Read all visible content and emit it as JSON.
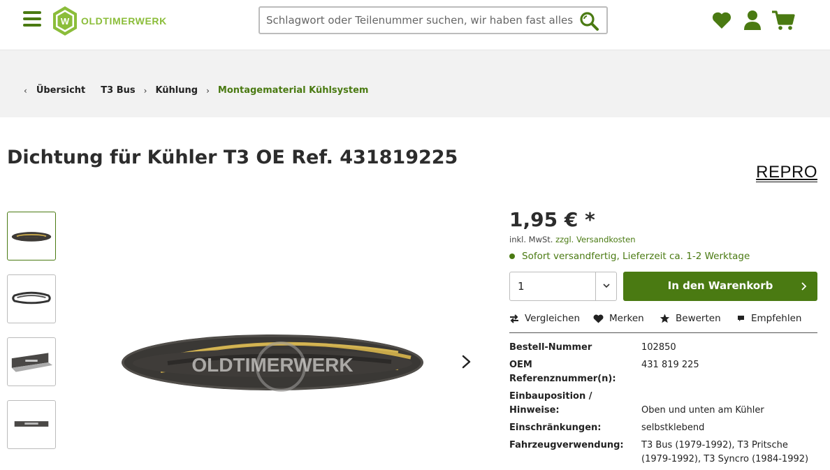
{
  "header": {
    "logo_text": "OLDTIMERWERK",
    "search_placeholder": "Schlagwort oder Teilenummer suchen, wir haben fast alles!",
    "icons": [
      "menu-icon",
      "heart-icon",
      "user-icon",
      "cart-icon",
      "search-icon"
    ]
  },
  "breadcrumb": [
    {
      "label": "Übersicht"
    },
    {
      "label": "T3 Bus"
    },
    {
      "label": "Kühlung"
    },
    {
      "label": "Montagematerial Kühlsystem"
    }
  ],
  "product": {
    "title": "Dichtung für Kühler T3 OE Ref. 431819225",
    "brand": "REPRO",
    "price": "1,95 € *",
    "tax_prefix": "inkl. MwSt.",
    "tax_link": "zzgl. Versandkosten",
    "availability": "Sofort versandfertig, Lieferzeit ca. 1-2 Werktage",
    "quantity": "1",
    "cart_button": "In den Warenkorb",
    "watermark": "OLDTIMERWERK"
  },
  "actions": [
    {
      "label": "Vergleichen",
      "icon": "compare-icon"
    },
    {
      "label": "Merken",
      "icon": "heart-icon"
    },
    {
      "label": "Bewerten",
      "icon": "star-icon"
    },
    {
      "label": "Empfehlen",
      "icon": "comment-icon"
    }
  ],
  "properties": [
    {
      "key": "Bestell-Nummer",
      "value": "102850"
    },
    {
      "key": "OEM Referenznummer(n):",
      "value": "431 819 225"
    },
    {
      "key": "Einbauposition / Hinweise:",
      "value": "Oben und unten am Kühler"
    },
    {
      "key": "Einschränkungen:",
      "value": "selbstklebend"
    },
    {
      "key": "Fahrzeugverwendung:",
      "value": "T3 Bus (1979-1992), T3 Pritsche (1979-1992), T3 Syncro (1984-1992)"
    }
  ],
  "colors": {
    "brand_green": "#4a7a12",
    "logo_green": "#8bbd3a",
    "band_gray": "#f2f2f2"
  }
}
